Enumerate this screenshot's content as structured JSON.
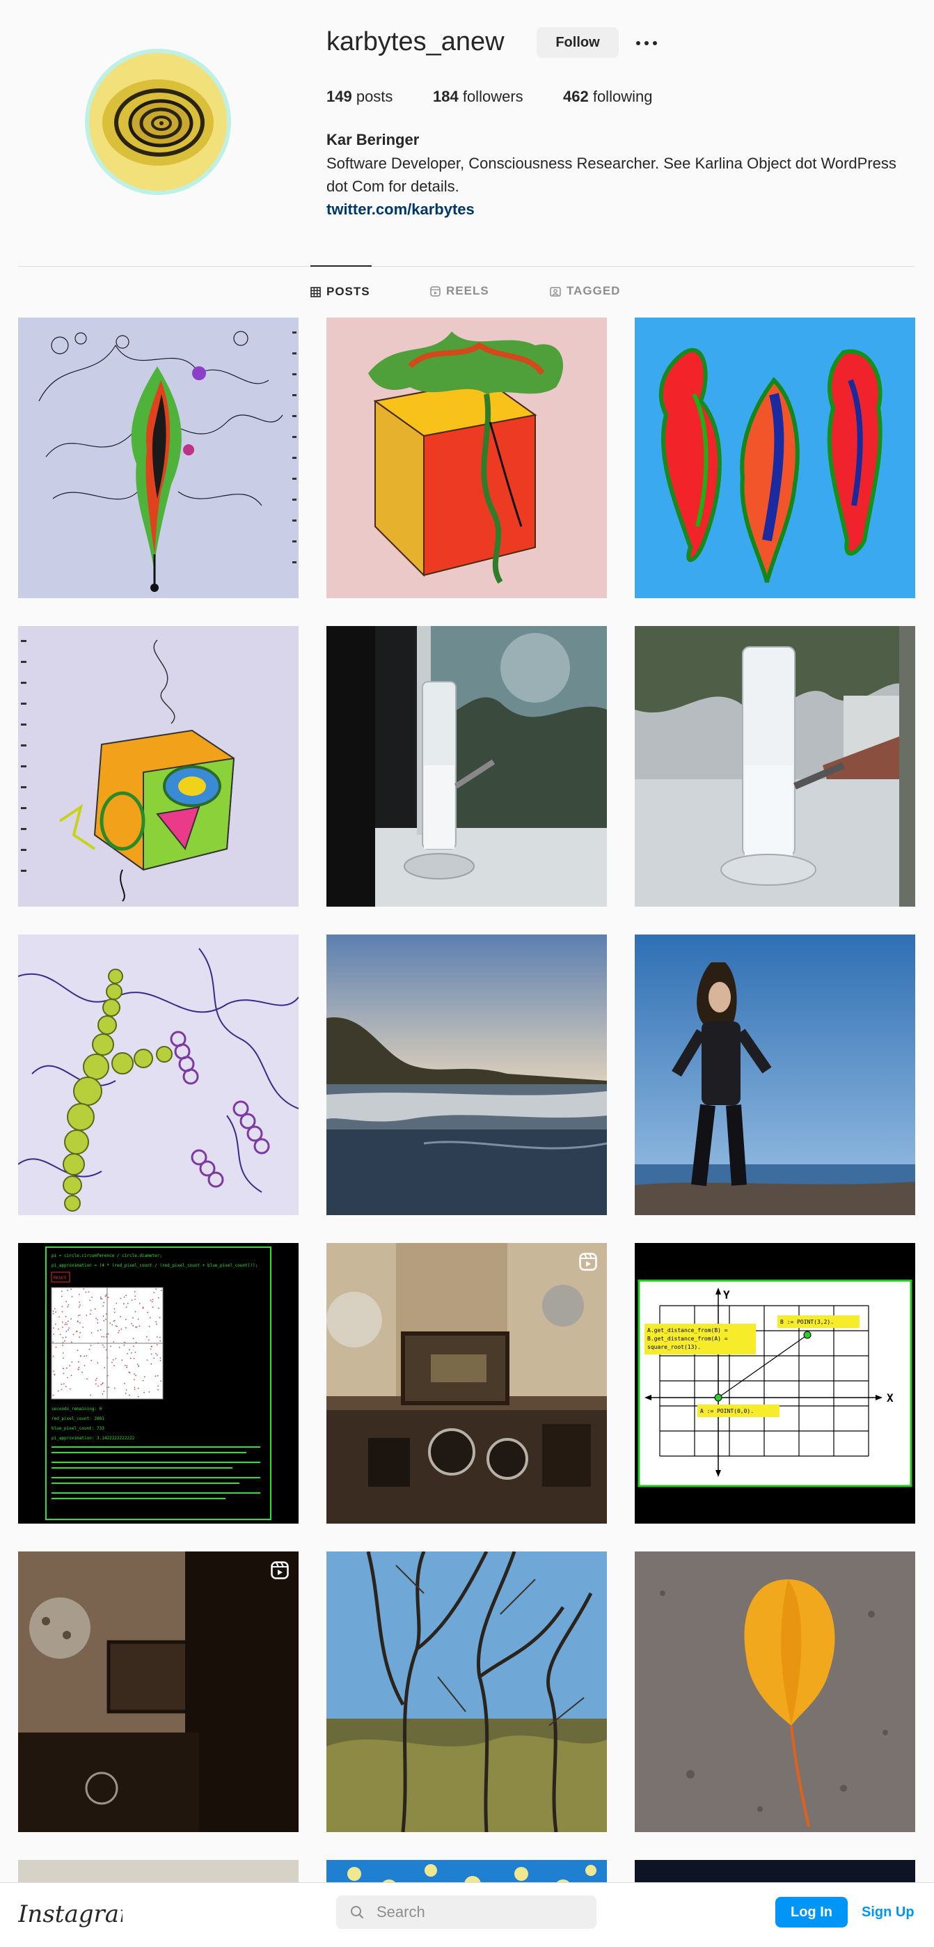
{
  "profile": {
    "username": "karbytes_anew",
    "follow_label": "Follow",
    "more_icon": "more-options-icon",
    "posts_count": "149",
    "posts_label": " posts",
    "followers_count": "184",
    "followers_label": " followers",
    "following_count": "462",
    "following_label": " following",
    "full_name": "Kar Beringer",
    "bio": "Software Developer, Consciousness Researcher. See Karlina Object dot WordPress dot Com for details.",
    "link": "twitter.com/karbytes"
  },
  "tabs": [
    {
      "label": "POSTS",
      "icon": "grid-icon",
      "active": true
    },
    {
      "label": "REELS",
      "icon": "reels-icon",
      "active": false
    },
    {
      "label": "TAGGED",
      "icon": "tagged-icon",
      "active": false
    }
  ],
  "posts": [
    {
      "subject": "ink drawing with flame",
      "reel": false
    },
    {
      "subject": "cube with colorful flames",
      "reel": false
    },
    {
      "subject": "three flames on blue",
      "reel": false
    },
    {
      "subject": "cube drawing with swirls",
      "reel": false
    },
    {
      "subject": "glass bong by window",
      "reel": false
    },
    {
      "subject": "glass bong outdoors",
      "reel": false
    },
    {
      "subject": "vine pattern drawing",
      "reel": false
    },
    {
      "subject": "beach at sunset",
      "reel": false
    },
    {
      "subject": "person standing on cliff",
      "reel": false
    },
    {
      "subject": "monte carlo code screenshot",
      "reel": false
    },
    {
      "subject": "room with drums",
      "reel": true
    },
    {
      "subject": "coordinate grid diagram",
      "reel": false
    },
    {
      "subject": "dark room",
      "reel": true
    },
    {
      "subject": "bare trees",
      "reel": false
    },
    {
      "subject": "yellow leaf on pavement",
      "reel": false
    }
  ],
  "code_post": {
    "lines": [
      "pi = circle.circumference / circle.diameter;",
      "pi_approximation = (4 * (red_pixel_count / (red_pixel_count + blue_pixel_count)));",
      "seconds_remaining: 0",
      "red_pixel_count: 2681",
      "blue_pixel_count: 733",
      "pi_approximation: 3.1422222222222"
    ],
    "reset": "RESET"
  },
  "diagram_post": {
    "axis_y": "Y",
    "axis_x": "X",
    "label_b": "B := POINT(3,2).",
    "label_a": "A := POINT(0,0).",
    "label_dist_1": "A.get_distance_from(B) =",
    "label_dist_2": "B.get_distance_from(A) =",
    "label_dist_3": "square_root(13)."
  },
  "bottom_bar": {
    "logo": "Instagram",
    "search_placeholder": "Search",
    "login_label": "Log In",
    "signup_label": "Sign Up"
  }
}
